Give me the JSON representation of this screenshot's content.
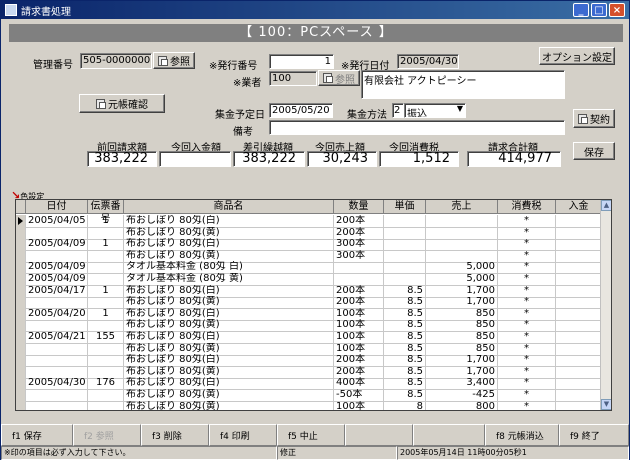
{
  "window": {
    "title": "請求書処理"
  },
  "banner": "【 100：PCスペース 】",
  "form": {
    "mgmt_label": "管理番号",
    "mgmt_value": "505-00000001",
    "ref_button": "参照",
    "issue_no_label": "※発行番号",
    "issue_no_value": "1",
    "issue_date_label": "※発行日付",
    "issue_date_value": "2005/04/30",
    "option_button": "オプション設定",
    "vendor_label": "※業者",
    "vendor_code": "100",
    "vendor_ref_button": "参照",
    "vendor_name": "有限会社 アクトピーシー",
    "ledger_button": "元帳確認",
    "collect_date_label": "集金予定日",
    "collect_date_value": "2005/05/20",
    "collect_method_label": "集金方法",
    "collect_method_code": "2",
    "collect_method_value": "振込",
    "contract_button": "契約",
    "note_label": "備考",
    "note_value": "",
    "save_button": "保存",
    "color_setting": "色設定"
  },
  "summary": {
    "headers": [
      "前回請求額",
      "今回入金額",
      "差引繰越額",
      "今回売上額",
      "今回消費税",
      "請求合計額"
    ],
    "values": [
      "383,222",
      "",
      "383,222",
      "30,243",
      "1,512",
      "414,977"
    ]
  },
  "table": {
    "headers": [
      "日付",
      "伝票番号",
      "商品名",
      "数量",
      "単価",
      "売上",
      "消費税",
      "入金"
    ],
    "rows": [
      [
        "2005/04/05",
        "1",
        "布おしぼり 80匁(白)",
        "200本",
        "",
        "",
        "*",
        ""
      ],
      [
        "",
        "",
        "布おしぼり 80匁(黄)",
        "200本",
        "",
        "",
        "*",
        ""
      ],
      [
        "2005/04/09",
        "1",
        "布おしぼり 80匁(白)",
        "300本",
        "",
        "",
        "*",
        ""
      ],
      [
        "",
        "",
        "布おしぼり 80匁(黄)",
        "300本",
        "",
        "",
        "*",
        ""
      ],
      [
        "2005/04/09",
        "",
        "タオル基本料金 (80匁 白)",
        "",
        "",
        "5,000",
        "*",
        ""
      ],
      [
        "2005/04/09",
        "",
        "タオル基本料金 (80匁 黄)",
        "",
        "",
        "5,000",
        "*",
        ""
      ],
      [
        "2005/04/17",
        "1",
        "布おしぼり 80匁(白)",
        "200本",
        "8.5",
        "1,700",
        "*",
        ""
      ],
      [
        "",
        "",
        "布おしぼり 80匁(黄)",
        "200本",
        "8.5",
        "1,700",
        "*",
        ""
      ],
      [
        "2005/04/20",
        "1",
        "布おしぼり 80匁(白)",
        "100本",
        "8.5",
        "850",
        "*",
        ""
      ],
      [
        "",
        "",
        "布おしぼり 80匁(黄)",
        "100本",
        "8.5",
        "850",
        "*",
        ""
      ],
      [
        "2005/04/21",
        "155",
        "布おしぼり 80匁(白)",
        "100本",
        "8.5",
        "850",
        "*",
        ""
      ],
      [
        "",
        "",
        "布おしぼり 80匁(黄)",
        "100本",
        "8.5",
        "850",
        "*",
        ""
      ],
      [
        "",
        "",
        "布おしぼり 80匁(白)",
        "200本",
        "8.5",
        "1,700",
        "*",
        ""
      ],
      [
        "",
        "",
        "布おしぼり 80匁(黄)",
        "200本",
        "8.5",
        "1,700",
        "*",
        ""
      ],
      [
        "2005/04/30",
        "176",
        "布おしぼり 80匁(白)",
        "400本",
        "8.5",
        "3,400",
        "*",
        ""
      ],
      [
        "",
        "",
        "布おしぼり 80匁(黄)",
        "-50本",
        "8.5",
        "-425",
        "*",
        ""
      ],
      [
        "",
        "",
        "布おしぼり 80匁(黄)",
        "100本",
        "8",
        "800",
        "*",
        ""
      ]
    ]
  },
  "fkeys": [
    {
      "label": "f1  保存",
      "enabled": true
    },
    {
      "label": "f2  参照",
      "enabled": false
    },
    {
      "label": "f3  削除",
      "enabled": true
    },
    {
      "label": "f4  印刷",
      "enabled": true
    },
    {
      "label": "f5  中止",
      "enabled": true
    },
    {
      "label": "",
      "enabled": true
    },
    {
      "label": "",
      "enabled": true
    },
    {
      "label": "f8  元帳消込",
      "enabled": true
    },
    {
      "label": "f9  終了",
      "enabled": true
    }
  ],
  "status": {
    "message": "※印の項目は必ず入力して下さい。",
    "mode": "修正",
    "datetime": "2005年05月14日 11時00分05秒1"
  }
}
